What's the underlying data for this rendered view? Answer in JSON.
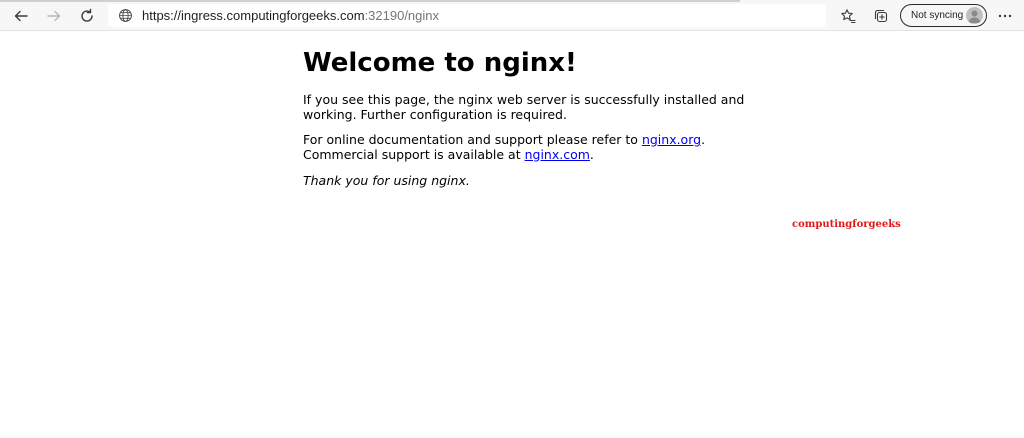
{
  "browser": {
    "url_host": "https://ingress.computingforgeeks.com",
    "url_rest": ":32190/nginx",
    "sync_label": "Not syncing",
    "icons": {
      "back": "back-arrow-icon",
      "forward": "forward-arrow-icon",
      "refresh": "refresh-icon",
      "site_info": "globe-icon",
      "favorites": "favorites-star-icon",
      "collections": "collections-icon",
      "profile": "profile-avatar-icon",
      "menu": "more-menu-icon"
    }
  },
  "page": {
    "title": "Welcome to nginx!",
    "para1_line1": "If you see this page, the nginx web server is successfully installed and",
    "para1_line2": "working. Further configuration is required.",
    "para2_prefix": "For online documentation and support please refer to ",
    "para2_link1": "nginx.org",
    "para2_mid_end": ".",
    "para2_line2_prefix": "Commercial support is available at ",
    "para2_link2": "nginx.com",
    "para2_line2_end": ".",
    "para3": "Thank you for using nginx."
  },
  "watermark": "computingforgeeks",
  "colors": {
    "link": "#0000ee",
    "watermark": "#e01818",
    "toolbar_bg": "#f7f7f7"
  }
}
